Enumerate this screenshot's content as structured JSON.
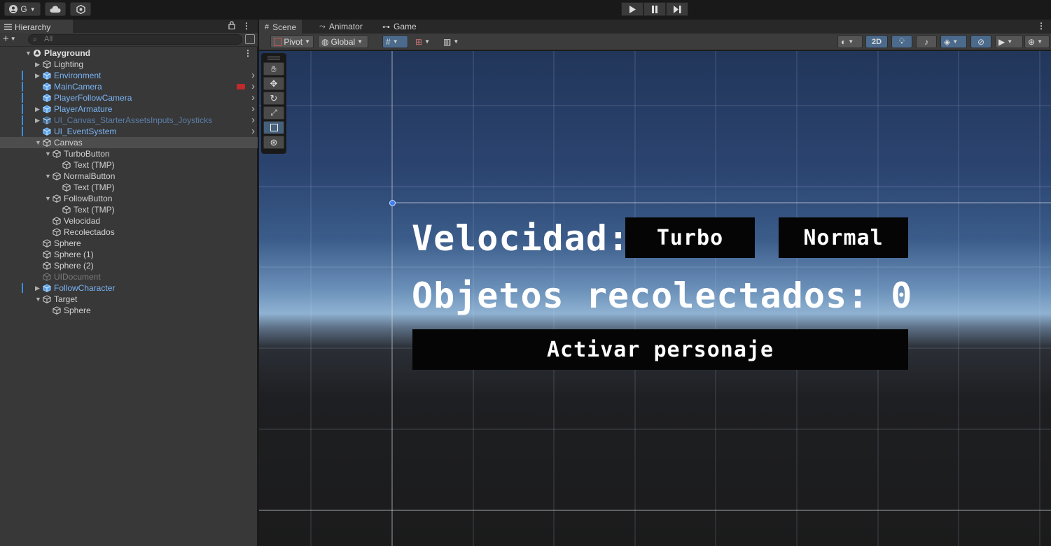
{
  "topbar": {
    "account_label": "G",
    "account_icon": "account-icon",
    "cloud_icon": "cloud-icon",
    "settings_icon": "settings-icon",
    "play_icon": "play-icon",
    "pause_icon": "pause-icon",
    "step_icon": "step-icon"
  },
  "hierarchy": {
    "tab_label": "Hierarchy",
    "search_placeholder": "All",
    "add_label": "+",
    "rows": [
      {
        "label": "Playground",
        "depth": 0,
        "expander": "open",
        "icon": "scene",
        "style": "bold",
        "kebab": true
      },
      {
        "label": "Lighting",
        "depth": 1,
        "expander": "closed",
        "icon": "gameobject",
        "style": "normal"
      },
      {
        "label": "Environment",
        "depth": 1,
        "expander": "closed",
        "icon": "prefab",
        "style": "prefab",
        "mark": true,
        "more": true
      },
      {
        "label": "MainCamera",
        "depth": 1,
        "expander": "none",
        "icon": "prefab",
        "style": "prefab",
        "mark": true,
        "more": true,
        "badge": true
      },
      {
        "label": "PlayerFollowCamera",
        "depth": 1,
        "expander": "none",
        "icon": "prefab",
        "style": "prefab",
        "mark": true,
        "more": true
      },
      {
        "label": "PlayerArmature",
        "depth": 1,
        "expander": "closed",
        "icon": "prefab",
        "style": "prefab",
        "mark": true,
        "more": true
      },
      {
        "label": "UI_Canvas_StarterAssetsInputs_Joysticks",
        "depth": 1,
        "expander": "closed",
        "icon": "prefab-dim",
        "style": "prefab-dim",
        "mark": true,
        "more": true
      },
      {
        "label": "UI_EventSystem",
        "depth": 1,
        "expander": "none",
        "icon": "prefab",
        "style": "prefab",
        "mark": true,
        "more": true
      },
      {
        "label": "Canvas",
        "depth": 1,
        "expander": "open",
        "icon": "gameobject",
        "style": "normal",
        "selected": true
      },
      {
        "label": "TurboButton",
        "depth": 2,
        "expander": "open",
        "icon": "gameobject",
        "style": "normal"
      },
      {
        "label": "Text (TMP)",
        "depth": 3,
        "expander": "none",
        "icon": "gameobject",
        "style": "normal"
      },
      {
        "label": "NormalButton",
        "depth": 2,
        "expander": "open",
        "icon": "gameobject",
        "style": "normal"
      },
      {
        "label": "Text (TMP)",
        "depth": 3,
        "expander": "none",
        "icon": "gameobject",
        "style": "normal"
      },
      {
        "label": "FollowButton",
        "depth": 2,
        "expander": "open",
        "icon": "gameobject",
        "style": "normal"
      },
      {
        "label": "Text (TMP)",
        "depth": 3,
        "expander": "none",
        "icon": "gameobject",
        "style": "normal"
      },
      {
        "label": "Velocidad",
        "depth": 2,
        "expander": "none",
        "icon": "gameobject",
        "style": "normal"
      },
      {
        "label": "Recolectados",
        "depth": 2,
        "expander": "none",
        "icon": "gameobject",
        "style": "normal"
      },
      {
        "label": "Sphere",
        "depth": 1,
        "expander": "none",
        "icon": "gameobject",
        "style": "normal"
      },
      {
        "label": "Sphere (1)",
        "depth": 1,
        "expander": "none",
        "icon": "gameobject",
        "style": "normal"
      },
      {
        "label": "Sphere (2)",
        "depth": 1,
        "expander": "none",
        "icon": "gameobject",
        "style": "normal"
      },
      {
        "label": "UIDocument",
        "depth": 1,
        "expander": "none",
        "icon": "gameobject-dim",
        "style": "dim"
      },
      {
        "label": "FollowCharacter",
        "depth": 1,
        "expander": "closed",
        "icon": "prefab",
        "style": "prefab",
        "mark": true
      },
      {
        "label": "Target",
        "depth": 1,
        "expander": "open",
        "icon": "gameobject",
        "style": "normal"
      },
      {
        "label": "Sphere",
        "depth": 2,
        "expander": "none",
        "icon": "gameobject",
        "style": "normal"
      }
    ]
  },
  "scene": {
    "tabs": [
      {
        "label": "Scene",
        "icon": "grid-icon",
        "active": true
      },
      {
        "label": "Animator",
        "icon": "animator-icon",
        "active": false
      },
      {
        "label": "Game",
        "icon": "gamepad-icon",
        "active": false
      }
    ],
    "toolbar": {
      "pivot_label": "Pivot",
      "global_label": "Global",
      "mode_2d_label": "2D"
    },
    "canvas_ui": {
      "velocidad_label": "Velocidad:",
      "turbo_button": "Turbo",
      "normal_button": "Normal",
      "objetos_label": "Objetos recolectados: 0",
      "activar_button": "Activar personaje"
    }
  }
}
